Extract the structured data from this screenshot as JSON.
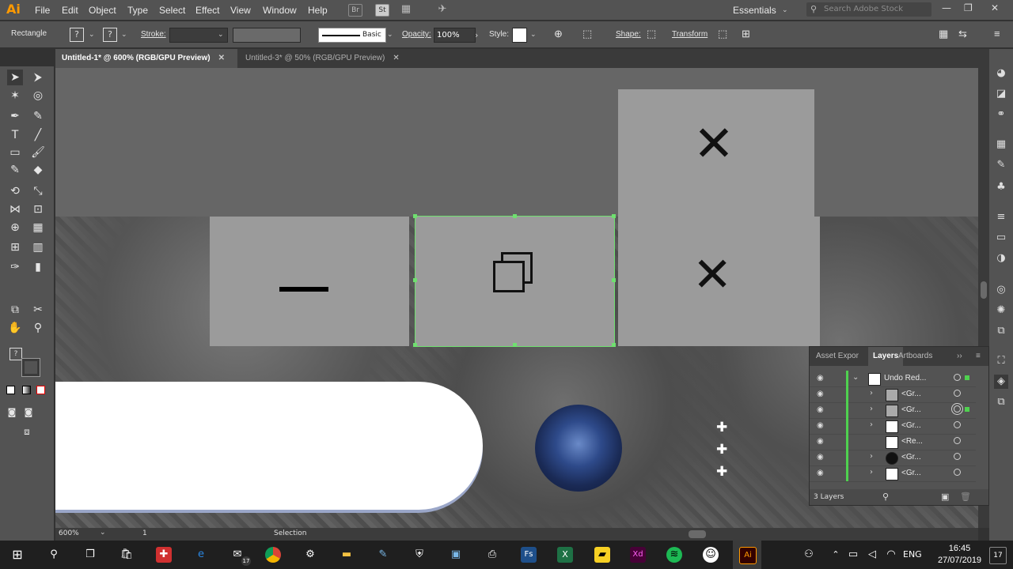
{
  "app": {
    "logo": "Ai"
  },
  "menu": [
    "File",
    "Edit",
    "Object",
    "Type",
    "Select",
    "Effect",
    "View",
    "Window",
    "Help"
  ],
  "toolbar_icons": {
    "bridge": "Br",
    "stock": "St",
    "arrange": "▦",
    "gpu": "✈"
  },
  "workspace": "Essentials",
  "search_placeholder": "Search Adobe Stock",
  "window_controls": [
    "—",
    "❐",
    "✕"
  ],
  "control_bar": {
    "tool_name": "Rectangle",
    "fill_q": "?",
    "stroke_q": "?",
    "stroke_label": "Stroke:",
    "basic": "Basic",
    "opacity_label": "Opacity:",
    "opacity": "100%",
    "style_label": "Style:",
    "shape_label": "Shape:",
    "transform_label": "Transform"
  },
  "tabs": [
    {
      "label": "Untitled-1* @ 600% (RGB/GPU Preview)",
      "close": "✕"
    },
    {
      "label": "Untitled-3* @ 50% (RGB/GPU Preview)",
      "close": "✕"
    }
  ],
  "canvas_glyphs": {
    "close_big": "✕",
    "minimize": "—",
    "plus": "✚"
  },
  "toolbox_q": "?",
  "layers_panel": {
    "tabs": [
      "Asset Expor",
      "Layers",
      "Artboards"
    ],
    "more": "››",
    "menu": "≡",
    "rows": [
      {
        "name": "Undo Red...",
        "twirl": "⌄"
      },
      {
        "name": "<Gr...",
        "twirl": "›"
      },
      {
        "name": "<Gr...",
        "twirl": "›"
      },
      {
        "name": "<Gr...",
        "twirl": "›"
      },
      {
        "name": "<Re...",
        "twirl": ""
      },
      {
        "name": "<Gr...",
        "twirl": "›"
      },
      {
        "name": "<Gr...",
        "twirl": "›"
      }
    ],
    "count": "3 Layers"
  },
  "status_bar": {
    "zoom": "600%",
    "artboard": "1",
    "mode": "Selection"
  },
  "taskbar": {
    "time": "16:45",
    "date": "27/07/2019",
    "lang": "ENG",
    "notif": "17",
    "mail_badge": "17",
    "apps": {
      "fs": "Fs",
      "excel": "X",
      "xd": "Xd",
      "ai": "Ai"
    }
  }
}
